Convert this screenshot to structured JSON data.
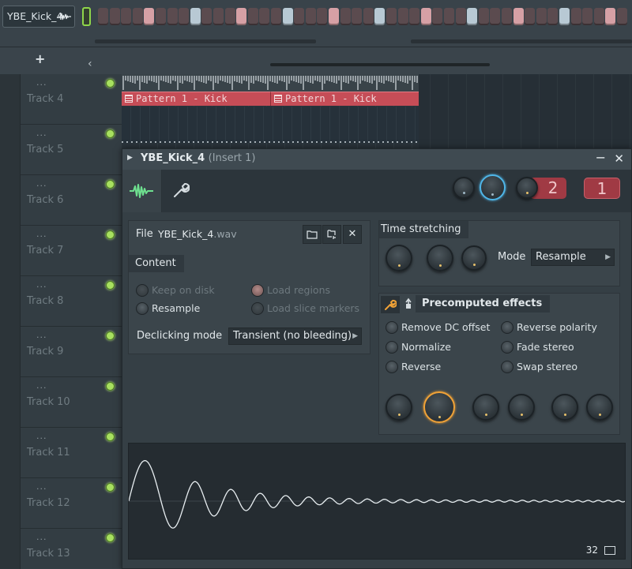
{
  "channel_rack": {
    "channel_name": "YBE_Kick_4",
    "channel_icon": "sample-wave-icon",
    "steps": [
      "dark",
      "dark",
      "dark",
      "dark",
      "pink",
      "dark",
      "dark",
      "dark",
      "blue",
      "dark",
      "dark",
      "dark",
      "pink",
      "dark",
      "dark",
      "dark",
      "blue",
      "dark",
      "dark",
      "dark",
      "pink",
      "dark",
      "dark",
      "dark",
      "blue",
      "dark",
      "dark",
      "dark",
      "pink",
      "dark",
      "dark",
      "dark",
      "blue",
      "dark",
      "dark",
      "dark",
      "pink",
      "dark",
      "dark",
      "dark",
      "blue",
      "dark",
      "dark",
      "dark",
      "pink",
      "dark"
    ]
  },
  "playlist": {
    "add_icon": "plus-icon",
    "collapse_icon": "chevron-left-icon",
    "tracks": [
      {
        "label": "Track 4"
      },
      {
        "label": "Track 5"
      },
      {
        "label": "Track 6"
      },
      {
        "label": "Track 7"
      },
      {
        "label": "Track 8"
      },
      {
        "label": "Track 9"
      },
      {
        "label": "Track 10"
      },
      {
        "label": "Track 11"
      },
      {
        "label": "Track 12"
      },
      {
        "label": "Track 13"
      }
    ],
    "track_dots": "...",
    "clips": [
      {
        "label": "Pattern 1 - Kick"
      },
      {
        "label": "Pattern 1 - Kick"
      }
    ]
  },
  "channel_settings": {
    "title": "YBE_Kick_4",
    "insert_label": "(Insert 1)",
    "minimize_icon": "minimize-icon",
    "close_icon": "close-icon",
    "tabs": [
      {
        "name": "sample-tab",
        "icon": "waveform-icon"
      },
      {
        "name": "wrench-tab",
        "icon": "wrench-icon"
      }
    ],
    "mixer_track": "2",
    "target_track": "1",
    "file": {
      "label": "File",
      "name": "YBE_Kick_4",
      "ext": ".wav",
      "browse_icon": "folder-icon",
      "locate_icon": "folder-locate-icon",
      "clear_icon": "close-icon"
    },
    "content": {
      "label": "Content",
      "options": [
        {
          "label": "Keep on disk",
          "enabled": false
        },
        {
          "label": "Load regions",
          "enabled": false
        },
        {
          "label": "Resample",
          "enabled": true
        },
        {
          "label": "Load slice markers",
          "enabled": false
        }
      ],
      "declicking_label": "Declicking mode",
      "declicking_value": "Transient (no bleeding)"
    },
    "time_stretching": {
      "label": "Time stretching",
      "mode_label": "Mode",
      "mode_value": "Resample"
    },
    "precomputed": {
      "label": "Precomputed effects",
      "effects": [
        {
          "label": "Remove DC offset"
        },
        {
          "label": "Reverse polarity"
        },
        {
          "label": "Normalize"
        },
        {
          "label": "Fade stereo"
        },
        {
          "label": "Reverse"
        },
        {
          "label": "Swap stereo"
        }
      ]
    },
    "waveform": {
      "zoom_label": "32",
      "fit_icon": "fit-view-icon"
    }
  },
  "colors": {
    "accent_green": "#8fd64a",
    "clip_red": "#c64d57",
    "knob_blue": "#4fb6e8",
    "knob_orange": "#f0a237",
    "badge_red": "#a03a44"
  }
}
